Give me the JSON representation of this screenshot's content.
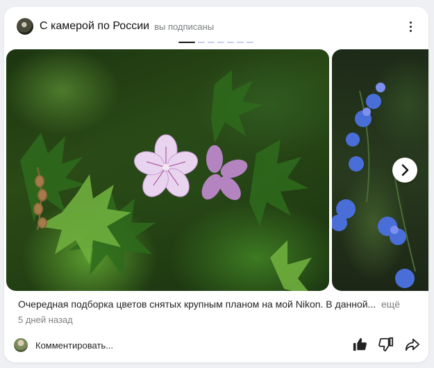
{
  "header": {
    "channel_name": "С камерой по России",
    "subscribed_label": "вы подписаны"
  },
  "gallery": {
    "current_index": 1,
    "total": 7
  },
  "caption": {
    "text": "Очередная подборка цветов снятых крупным планом на мой Nikon. В данной...",
    "more_label": "ещё",
    "date": "5 дней назад"
  },
  "footer": {
    "comment_placeholder": "Комментировать..."
  },
  "icons": {
    "menu": "more-vertical-icon",
    "next": "chevron-right-icon",
    "like": "thumbs-up-icon",
    "dislike": "thumbs-down-icon",
    "share": "share-icon"
  },
  "colors": {
    "pager_active": "#111111",
    "pager_inactive": "#c6cbe8",
    "muted_text": "#7b7d80"
  }
}
